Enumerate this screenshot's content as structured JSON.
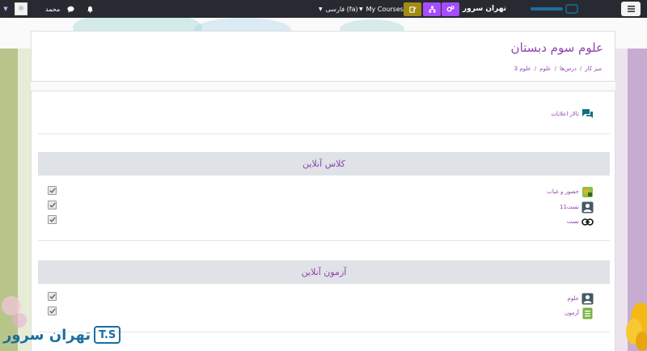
{
  "navbar": {
    "user_name": "محمد",
    "language": "فارسی (fa)",
    "my_courses": "My Courses",
    "site_name": "تهران سرور"
  },
  "header": {
    "title": "علوم سوم دبستان",
    "breadcrumbs": [
      "میز کار",
      "درس‌ها",
      "علوم",
      "علوم 3"
    ]
  },
  "content": {
    "forum_label": "تالار اعلانات",
    "sections": [
      {
        "title": "کلاس آنلاین",
        "activities": [
          {
            "label": "حضور و غیاب",
            "icon": "attendance-icon"
          },
          {
            "label": "تست11",
            "icon": "bigbluebutton-icon"
          },
          {
            "label": "تست",
            "icon": "url-link-icon"
          }
        ]
      },
      {
        "title": "آزمون آنلاین",
        "activities": [
          {
            "label": "علوم",
            "icon": "bigbluebutton-icon"
          },
          {
            "label": "آزمون",
            "icon": "quiz-icon"
          }
        ]
      }
    ]
  },
  "logo": {
    "text": "تهران سرور",
    "mark": "T.S"
  },
  "colors": {
    "accent": "#8e44ad",
    "navbar": "#272a31",
    "btn_olive": "#a38a12",
    "btn_purple": "#a64dff"
  }
}
